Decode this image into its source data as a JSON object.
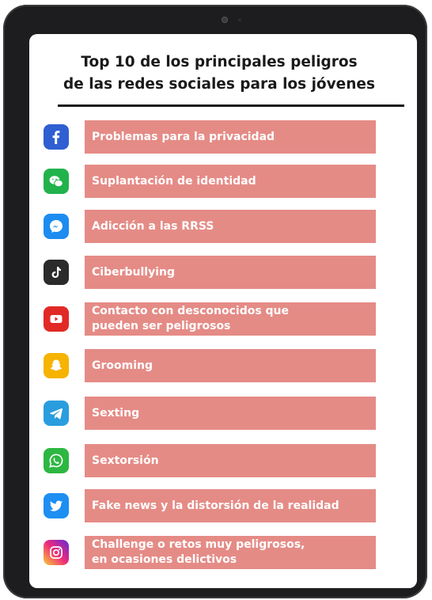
{
  "title": {
    "line1": "Top 10 de los principales peligros",
    "line2": "de las redes sociales para los jóvenes"
  },
  "items": [
    {
      "icon": "facebook-icon",
      "color": "#2f5fd0",
      "line1": "Problemas para la privacidad",
      "line2": ""
    },
    {
      "icon": "wechat-icon",
      "color": "#22b24c",
      "line1": "Suplantación de identidad",
      "line2": ""
    },
    {
      "icon": "messenger-icon",
      "color": "#1d8cf0",
      "line1": "Adicción a las RRSS",
      "line2": ""
    },
    {
      "icon": "tiktok-icon",
      "color": "#2b2b2b",
      "line1": "Ciberbullying",
      "line2": ""
    },
    {
      "icon": "youtube-icon",
      "color": "#e12a26",
      "line1": "Contacto con desconocidos que",
      "line2": "pueden ser peligrosos"
    },
    {
      "icon": "snapchat-icon",
      "color": "#f6b300",
      "line1": "Grooming",
      "line2": ""
    },
    {
      "icon": "telegram-icon",
      "color": "#2a9ddf",
      "line1": "Sexting",
      "line2": ""
    },
    {
      "icon": "whatsapp-icon",
      "color": "#2db742",
      "line1": "Sextorsión",
      "line2": ""
    },
    {
      "icon": "twitter-icon",
      "color": "#1d8ff2",
      "line1": "Fake news y la distorsión de la realidad",
      "line2": ""
    },
    {
      "icon": "instagram-icon",
      "color": "#c13584",
      "line1": "Challenge o retos muy peligrosos,",
      "line2": "en ocasiones delictivos"
    }
  ],
  "colors": {
    "bar": "#e58b86",
    "bar_text": "#ffffff",
    "tablet": "#1d1d1f"
  }
}
